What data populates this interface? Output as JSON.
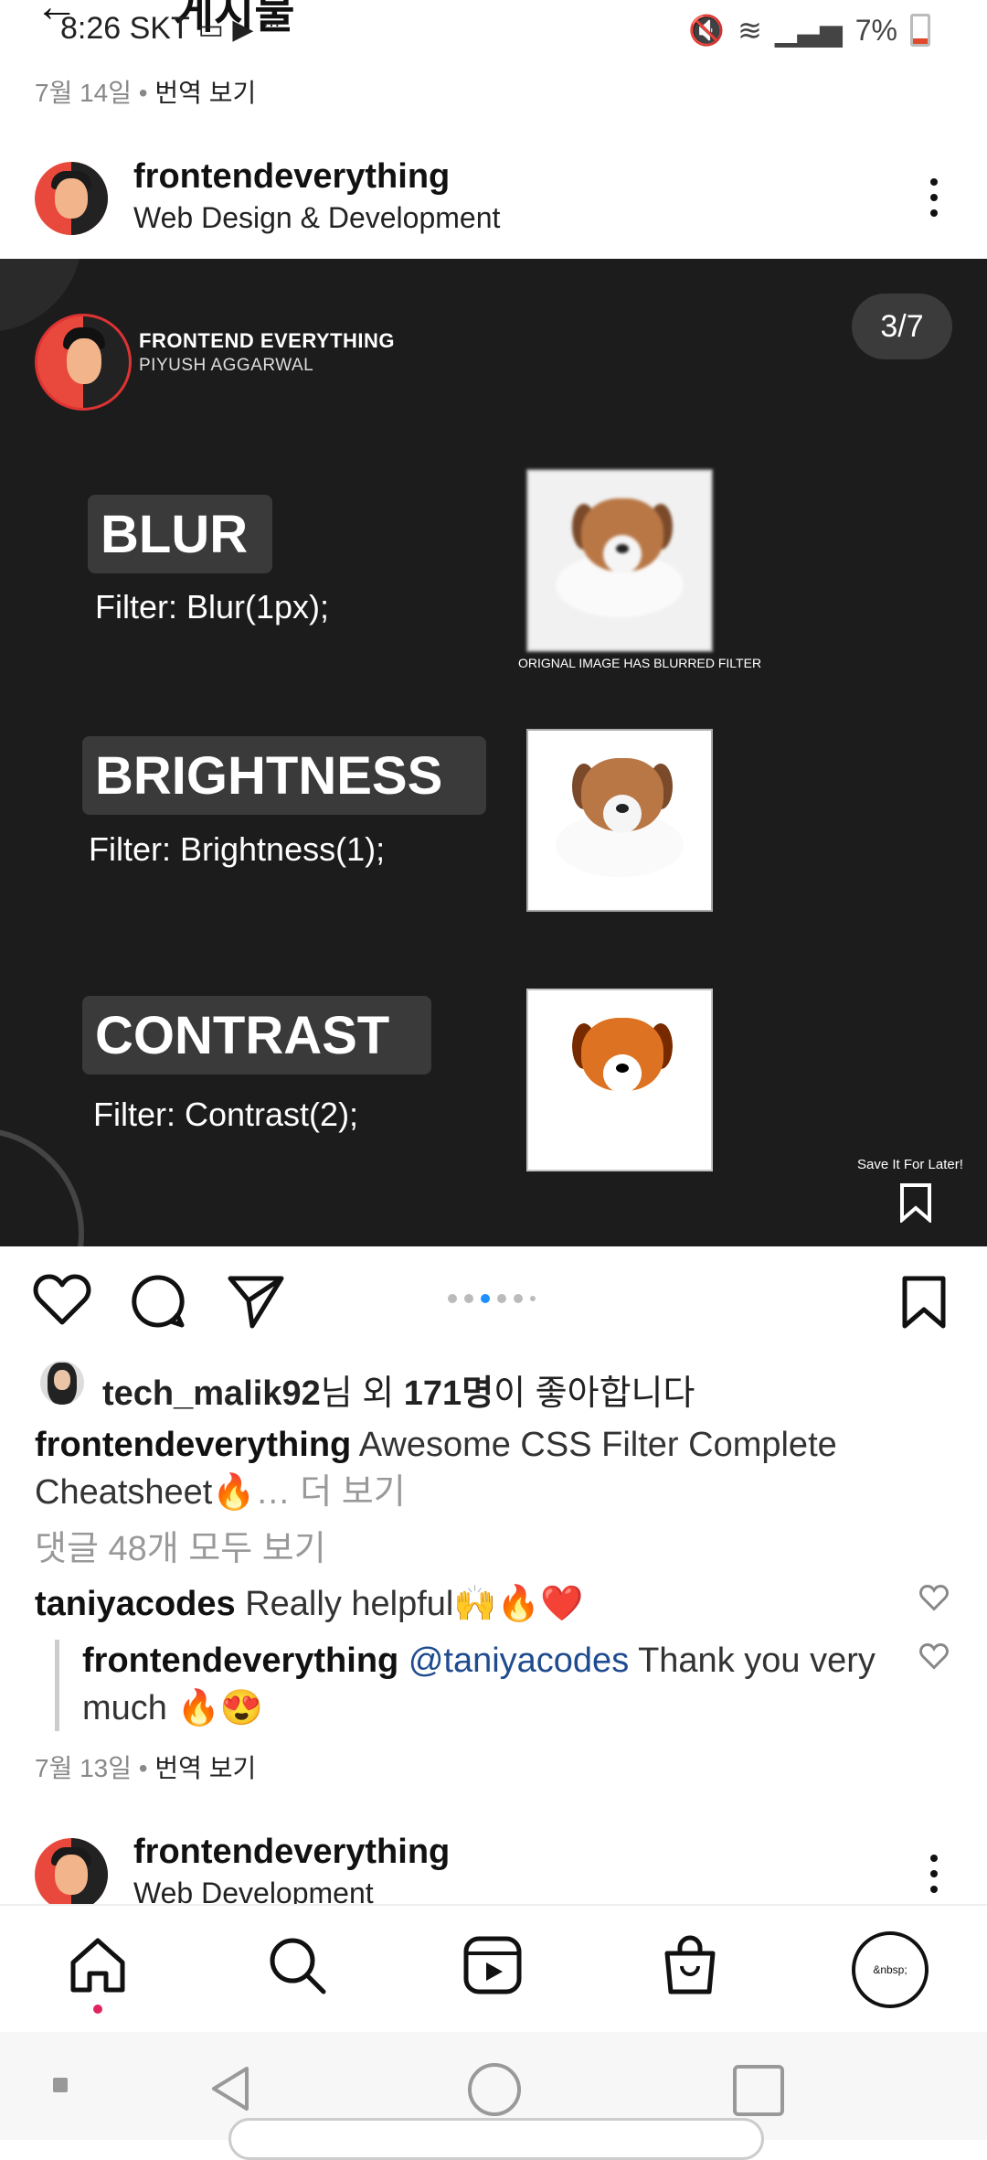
{
  "status_bar": {
    "time": "8:26 SKT",
    "battery": "7%",
    "more": "…"
  },
  "header": {
    "title_fragment": "게시물"
  },
  "post_top_meta": {
    "date": "7월 14일",
    "translate": "번역 보기"
  },
  "post": {
    "username": "frontendeverything",
    "subtitle": "Web Design & Development",
    "slide": {
      "brand_name": "FRONTEND EVERYTHING",
      "brand_author": "PIYUSH AGGARWAL",
      "counter": "3/7",
      "items": [
        {
          "label": "BLUR",
          "code": "Filter: Blur(1px);",
          "caption": "ORIGNAL IMAGE HAS BLURRED FILTER"
        },
        {
          "label": "BRIGHTNESS",
          "code": "Filter: Brightness(1);"
        },
        {
          "label": "CONTRAST",
          "code": "Filter: Contrast(2);"
        }
      ],
      "save_later": "Save It For Later!"
    },
    "likes": {
      "user": "tech_malik92",
      "mid": "님 외 ",
      "count": "171명",
      "suffix": "이 좋아합니다"
    },
    "caption": {
      "user": "frontendeverything",
      "text": "Awesome CSS Filter Complete Cheatsheet",
      "more": "… 더 보기"
    },
    "view_comments": "댓글 48개 모두 보기",
    "comments": [
      {
        "user": "taniyacodes",
        "text": "Really helpful"
      },
      {
        "user": "frontendeverything",
        "mention": "@taniyacodes",
        "text": "Thank you very much"
      }
    ],
    "date": "7월 13일",
    "translate": "번역 보기"
  },
  "next_post": {
    "username": "frontendeverything",
    "subtitle": "Web Development"
  },
  "bottom_nav": {
    "profile_label": "&nbsp;"
  },
  "colors": {
    "accent": "#1e90ff",
    "slide_bg": "#1c1c1c",
    "heart_red": "#e0245e"
  }
}
